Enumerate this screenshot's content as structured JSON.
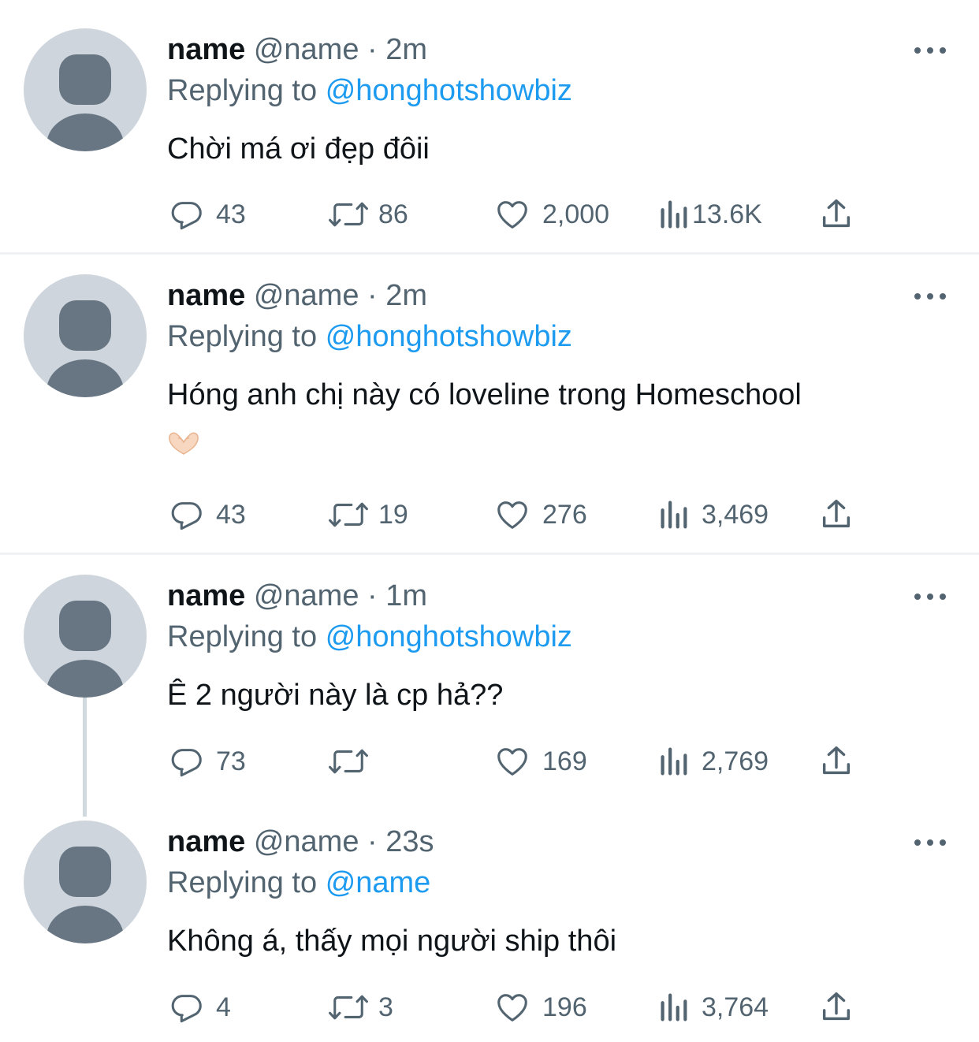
{
  "tweets": [
    {
      "name": "name",
      "handle": "@name",
      "separator": "·",
      "time": "2m",
      "replying_prefix": "Replying to",
      "replying_to": "@honghotshowbiz",
      "text_line1": "Chời má ơi đẹp đôii",
      "text_line2": "",
      "replies": "43",
      "retweets": "86",
      "likes": "2,000",
      "views": "13.6K"
    },
    {
      "name": "name",
      "handle": "@name",
      "separator": "·",
      "time": "2m",
      "replying_prefix": "Replying to",
      "replying_to": "@honghotshowbiz",
      "text_line1": "Hóng anh chị này có loveline trong Homeschool",
      "text_line2": "🫶",
      "replies": "43",
      "retweets": "19",
      "likes": "276",
      "views": "3,469"
    },
    {
      "name": "name",
      "handle": "@name",
      "separator": "·",
      "time": "1m",
      "replying_prefix": "Replying to",
      "replying_to": "@honghotshowbiz",
      "text_line1": "Ê 2 người này là cp hả??",
      "text_line2": "",
      "replies": "73",
      "retweets": "",
      "likes": "169",
      "views": "2,769"
    },
    {
      "name": "name",
      "handle": "@name",
      "separator": "·",
      "time": "23s",
      "replying_prefix": "Replying to",
      "replying_to": "@name",
      "text_line1": "Không á, thấy mọi người ship thôi",
      "text_line2": "",
      "replies": "4",
      "retweets": "3",
      "likes": "196",
      "views": "3,764"
    }
  ],
  "icons": {
    "reply": "reply-icon",
    "retweet": "retweet-icon",
    "like": "heart-icon",
    "views": "views-icon",
    "share": "share-icon",
    "more": "more-icon",
    "avatar": "default-avatar-icon",
    "heart_hands": "heart-hands-emoji"
  },
  "colors": {
    "text": "#0f1419",
    "secondary": "#536471",
    "link": "#1d9bf0",
    "avatar_bg": "#ced5dc",
    "avatar_fg": "#687684",
    "divider": "#eff3f4",
    "thread_line": "#cfd9de"
  }
}
